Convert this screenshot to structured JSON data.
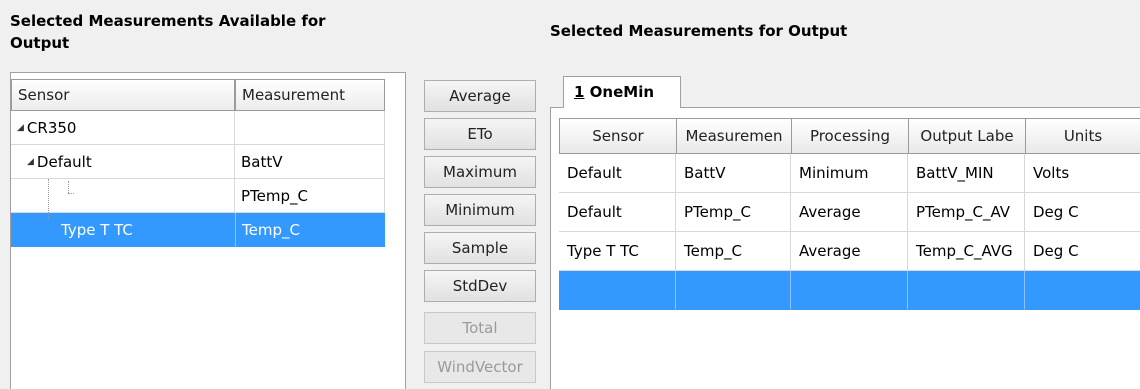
{
  "left": {
    "heading": "Selected Measurements Available for Output",
    "columns": [
      "Sensor",
      "Measurement"
    ],
    "rows": [
      {
        "sensor": "CR350",
        "measurement": ""
      },
      {
        "sensor": "Default",
        "measurement": "BattV"
      },
      {
        "sensor": "",
        "measurement": "PTemp_C"
      },
      {
        "sensor": "Type T TC",
        "measurement": "Temp_C"
      }
    ]
  },
  "processing_buttons": [
    {
      "label": "Average",
      "enabled": true
    },
    {
      "label": "ETo",
      "enabled": true
    },
    {
      "label": "Maximum",
      "enabled": true
    },
    {
      "label": "Minimum",
      "enabled": true
    },
    {
      "label": "Sample",
      "enabled": true
    },
    {
      "label": "StdDev",
      "enabled": true
    },
    {
      "label": "Total",
      "enabled": false
    },
    {
      "label": "WindVector",
      "enabled": false
    }
  ],
  "right": {
    "heading": "Selected Measurements for Output",
    "tab": {
      "accelerator": "1",
      "label": " OneMin"
    },
    "columns": [
      "Sensor",
      "Measuremen",
      "Processing",
      "Output Labe",
      "Units"
    ],
    "rows": [
      [
        "Default",
        "BattV",
        "Minimum",
        "BattV_MIN",
        "Volts"
      ],
      [
        "Default",
        "PTemp_C",
        "Average",
        "PTemp_C_AV",
        "Deg C"
      ],
      [
        "Type T TC",
        "Temp_C",
        "Average",
        "Temp_C_AVG",
        "Deg C"
      ],
      [
        "",
        "",
        "",
        "",
        ""
      ]
    ]
  },
  "colors": {
    "selection": "#3399ff"
  }
}
